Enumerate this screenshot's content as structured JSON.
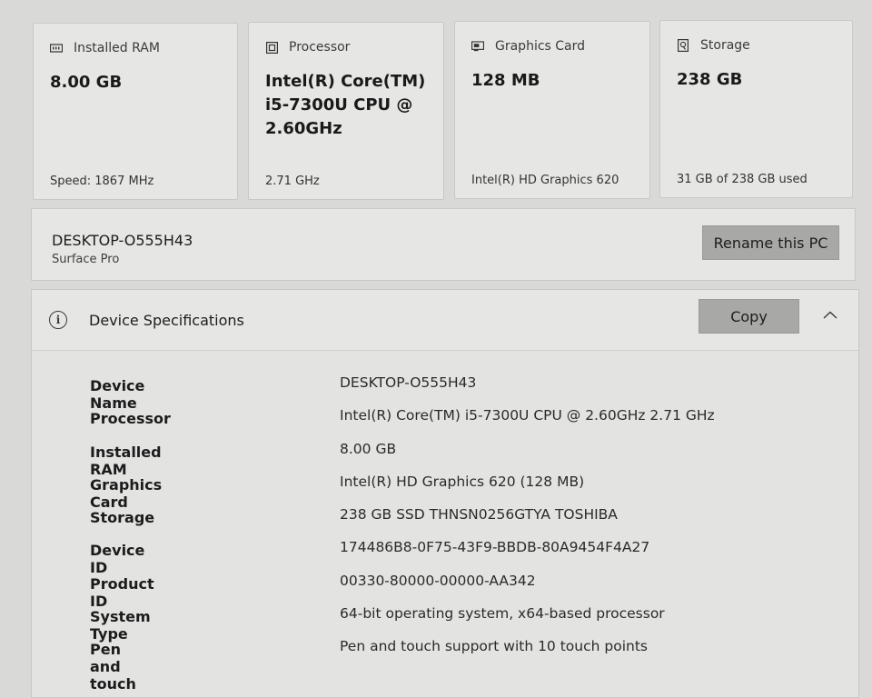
{
  "cards": [
    {
      "title": "Installed RAM",
      "icon": "ram-icon",
      "value": "8.00 GB",
      "sub": "Speed: 1867 MHz"
    },
    {
      "title": "Processor",
      "icon": "processor-icon",
      "value": "Intel(R) Core(TM) i5-7300U CPU @ 2.60GHz",
      "sub": "2.71 GHz"
    },
    {
      "title": "Graphics Card",
      "icon": "graphics-card-icon",
      "value": "128 MB",
      "sub": "Intel(R) HD Graphics 620"
    },
    {
      "title": "Storage",
      "icon": "storage-icon",
      "value": "238 GB",
      "sub": "31 GB of 238 GB used"
    }
  ],
  "pc": {
    "name": "DESKTOP-O555H43",
    "model": "Surface Pro",
    "rename_label": "Rename this PC"
  },
  "specs": {
    "title": "Device Specifications",
    "copy_label": "Copy",
    "rows": [
      {
        "label": "Device Name",
        "value": "DESKTOP-O555H43"
      },
      {
        "label": "Processor",
        "value": "Intel(R) Core(TM) i5-7300U CPU @ 2.60GHz   2.71 GHz"
      },
      {
        "label": "Installed RAM",
        "value": "8.00 GB"
      },
      {
        "label": "Graphics Card",
        "value": "Intel(R) HD Graphics 620 (128 MB)"
      },
      {
        "label": "Storage",
        "value": "238 GB SSD THNSN0256GTYA TOSHIBA"
      },
      {
        "label": "Device ID",
        "value": "174486B8-0F75-43F9-BBDB-80A9454F4A27"
      },
      {
        "label": "Product ID",
        "value": "00330-80000-00000-AA342"
      },
      {
        "label": "System Type",
        "value": "64-bit operating system, x64-based processor"
      },
      {
        "label": "Pen and touch",
        "value": "Pen and touch support with 10 touch points"
      }
    ]
  }
}
